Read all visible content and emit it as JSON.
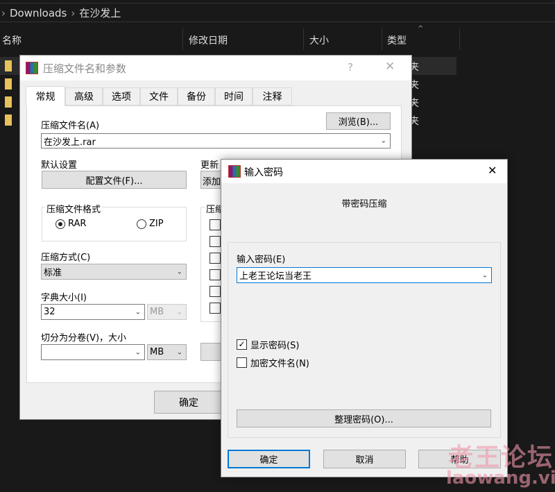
{
  "explorer": {
    "breadcrumb": [
      "Downloads",
      "在沙发上"
    ],
    "columns": [
      "名称",
      "修改日期",
      "大小",
      "类型"
    ],
    "row_type_text": [
      "夹",
      "夹",
      "夹",
      "夹"
    ]
  },
  "archive_dialog": {
    "title": "压缩文件名和参数",
    "help": "?",
    "close": "✕",
    "tabs": [
      "常规",
      "高级",
      "选项",
      "文件",
      "备份",
      "时间",
      "注释"
    ],
    "archive_name_label": "压缩文件名(A)",
    "browse": "浏览(B)...",
    "archive_name_value": "在沙发上.rar",
    "default_settings_label": "默认设置",
    "profiles_button": "配置文件(F)...",
    "update_label": "更新",
    "update_value": "添加",
    "format_label": "压缩文件格式",
    "format_options": [
      "RAR",
      "ZIP"
    ],
    "format_selected": "RAR",
    "options_label": "压缩",
    "method_label": "压缩方式(C)",
    "method_value": "标准",
    "dict_label": "字典大小(I)",
    "dict_value": "32",
    "dict_unit": "MB",
    "split_label": "切分为分卷(V)，大小",
    "split_value": "",
    "split_unit": "MB",
    "ok": "确定"
  },
  "password_dialog": {
    "title": "输入密码",
    "close": "✕",
    "heading": "带密码压缩",
    "password_label": "输入密码(E)",
    "password_value": "上老王论坛当老王",
    "show_password": "显示密码(S)",
    "show_password_checked": true,
    "encrypt_names": "加密文件名(N)",
    "encrypt_names_checked": false,
    "organize": "整理密码(O)...",
    "ok": "确定",
    "cancel": "取消",
    "help": "帮助"
  },
  "watermark": {
    "line1": "老王论坛",
    "line2": "laowang.vip"
  }
}
